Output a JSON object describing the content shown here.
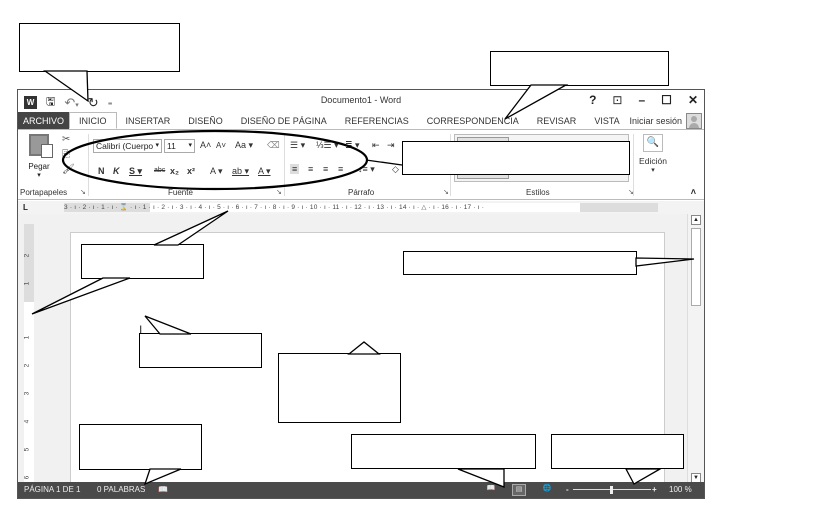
{
  "window": {
    "title": "Documento1 - Word",
    "controls": {
      "help": "?",
      "ribbon_display": "⊡",
      "minimize": "–",
      "maximize": "☐",
      "close": "✕"
    }
  },
  "quick_access": {
    "app_icon": "W",
    "save": "🖫",
    "undo": "↶",
    "undo_dropdown": "▾",
    "redo": "↻",
    "customize": "₌"
  },
  "tabs": [
    {
      "label": "ARCHIVO"
    },
    {
      "label": "INICIO"
    },
    {
      "label": "INSERTAR"
    },
    {
      "label": "DISEÑO"
    },
    {
      "label": "DISEÑO DE PÁGINA"
    },
    {
      "label": "REFERENCIAS"
    },
    {
      "label": "CORRESPONDENCIA"
    },
    {
      "label": "REVISAR"
    },
    {
      "label": "VISTA"
    }
  ],
  "signin": "Iniciar sesión",
  "ribbon": {
    "clipboard": {
      "paste_label": "Pegar",
      "paste_arrow": "▾",
      "cut": "✂",
      "copy": "⎘",
      "format_painter": "🖌",
      "group_label": "Portapapeles",
      "launcher": "↘"
    },
    "font": {
      "font_name": "Calibri (Cuerpo",
      "font_size": "11",
      "dropdown": "▾",
      "grow": "A˄",
      "shrink": "A˅",
      "change_case": "Aa ▾",
      "clear_format": "⌫",
      "bold": "N",
      "italic": "K",
      "underline": "S ▾",
      "strike": "abc",
      "subscript": "x₂",
      "superscript": "x²",
      "text_effects": "A ▾",
      "highlight": "ab ▾",
      "font_color": "A ▾",
      "group_label": "Fuente",
      "launcher": "↘"
    },
    "paragraph": {
      "bullets": "☰ ▾",
      "numbering": "⅓☰ ▾",
      "multilevel": "≣ ▾",
      "decrease_indent": "⇤",
      "increase_indent": "⇥",
      "align_left": "≡",
      "center": "≡",
      "align_right": "≡",
      "justify": "≡",
      "line_spacing": "↕≡ ▾",
      "shading": "◇",
      "group_label": "Párrafo",
      "launcher": "↘"
    },
    "styles": {
      "group_label": "Estilos",
      "launcher": "↘"
    },
    "editing": {
      "icon": "🔍",
      "label": "Edición",
      "arrow": "▾"
    },
    "collapse": "˄"
  },
  "ruler": {
    "tab_selector": "L",
    "horizontal": "3 · ı · 2 · ı · 1 · ı · ⌛ · ı · 1 · ı · 2 · ı · 3 · ı · 4 · ı · 5 · ı · 6 · ı · 7 · ı · 8 · ı · 9 · ı · 10 · ı · 11 · ı · 12 · ı · 13 · ı · 14 · ı · △ · ı · 16 · ı · 17 · ı ·",
    "vertical": [
      "2",
      "1",
      "1",
      "2",
      "3",
      "4",
      "5",
      "6"
    ]
  },
  "document": {
    "cursor": "I"
  },
  "scrollbar": {
    "up": "▲",
    "down": "▼"
  },
  "status": {
    "page": "PÁGINA 1 DE 1",
    "words": "0 PALABRAS",
    "proofing_icon": "📖",
    "read_mode": "📖",
    "print_layout": "▤",
    "web_layout": "🌐",
    "zoom_minus": "-",
    "zoom_plus": "+",
    "zoom_level": "100 %",
    "zoom_value_percent": 100
  }
}
